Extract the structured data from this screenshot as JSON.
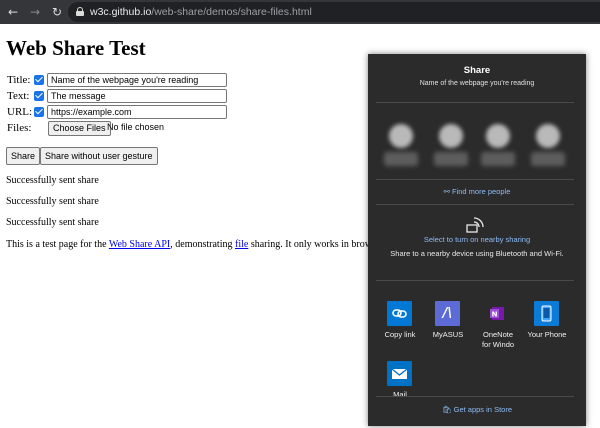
{
  "browser": {
    "url_host": "w3c.github.io",
    "url_path": "/web-share/demos/share-files.html"
  },
  "page": {
    "heading": "Web Share Test",
    "fields": {
      "title_label": "Title:",
      "title_value": "Name of the webpage you're reading",
      "text_label": "Text:",
      "text_value": "The message",
      "url_label": "URL:",
      "url_value": "https://example.com",
      "files_label": "Files:",
      "choose_files": "Choose Files",
      "no_file": "No file chosen"
    },
    "buttons": {
      "share": "Share",
      "share_no_gesture": "Share without user gesture"
    },
    "status_lines": [
      "Successfully sent share",
      "Successfully sent share",
      "Successfully sent share"
    ],
    "description": {
      "before": "This is a test page for the ",
      "api_link": "Web Share API",
      "middle": ", demonstrating ",
      "file_link": "file",
      "after": " sharing. It only works in brow"
    }
  },
  "share_dialog": {
    "title": "Share",
    "subtitle": "Name of the webpage you're reading",
    "find_people": "Find more people",
    "nearby_title": "Select to turn on nearby sharing",
    "nearby_desc": "Share to a nearby device using Bluetooth and Wi-Fi.",
    "apps": [
      {
        "name": "Copy link",
        "color": "#0078d4",
        "icon": "link-icon"
      },
      {
        "name": "MyASUS",
        "color": "#5c6bd6",
        "icon": "myasus-icon"
      },
      {
        "name": "OneNote\nfor Windo",
        "color": "#7719aa",
        "icon": "onenote-icon"
      },
      {
        "name": "Your Phone",
        "color": "#0a7bd7",
        "icon": "phone-icon"
      },
      {
        "name": "Mail",
        "color": "#0072c6",
        "icon": "mail-icon"
      }
    ],
    "store_link": "Get apps in Store"
  }
}
